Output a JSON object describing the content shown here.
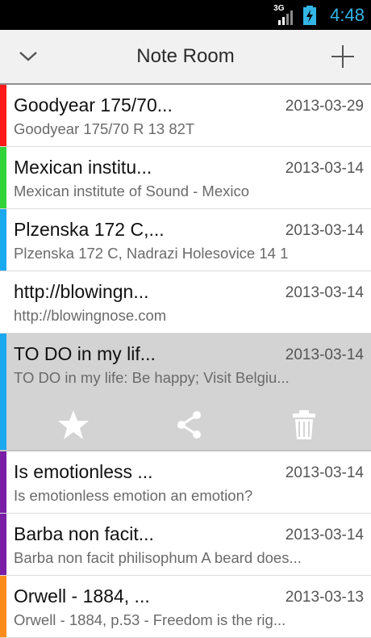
{
  "status": {
    "network": "3G",
    "time": "4:48",
    "icons": [
      "signal-icon",
      "battery-charging-icon"
    ]
  },
  "actionbar": {
    "title": "Note Room",
    "left_icon": "chevron-down-icon",
    "right_icon": "plus-icon"
  },
  "colors": {
    "red": "#ff1a1a",
    "green": "#33d43a",
    "blue": "#1aa8ef",
    "purple": "#7a1ea6",
    "orange": "#ff8c1a",
    "accent": "#33b5e5"
  },
  "notes": [
    {
      "title": "Goodyear 175/70...",
      "date": "2013-03-29",
      "preview": "Goodyear 175/70 R 13 82T",
      "color": "#ff1a1a"
    },
    {
      "title": "Mexican institu...",
      "date": "2013-03-14",
      "preview": "Mexican institute of Sound - Mexico",
      "color": "#33d43a"
    },
    {
      "title": "Plzenska 172 C,...",
      "date": "2013-03-14",
      "preview": "Plzenska 172 C, Nadrazi Holesovice 14 1",
      "color": "#1aa8ef"
    },
    {
      "title": "http://blowingn...",
      "date": "2013-03-14",
      "preview": "http://blowingnose.com",
      "color": "#ffffff"
    },
    {
      "title": "TO DO in my lif...",
      "date": "2013-03-14",
      "preview": "TO DO in my life: Be happy; Visit Belgiu...",
      "color": "#1aa8ef"
    },
    {
      "title": "Is emotionless ...",
      "date": "2013-03-14",
      "preview": "Is emotionless emotion an emotion?",
      "color": "#7a1ea6"
    },
    {
      "title": "Barba non facit...",
      "date": "2013-03-14",
      "preview": "Barba non facit philisophum A beard does...",
      "color": "#7a1ea6"
    },
    {
      "title": "Orwell - 1884, ...",
      "date": "2013-03-13",
      "preview": "Orwell - 1884, p.53 - Freedom is the rig...",
      "color": "#ff8c1a"
    }
  ],
  "selected_actions": [
    "star-icon",
    "share-icon",
    "trash-icon"
  ]
}
